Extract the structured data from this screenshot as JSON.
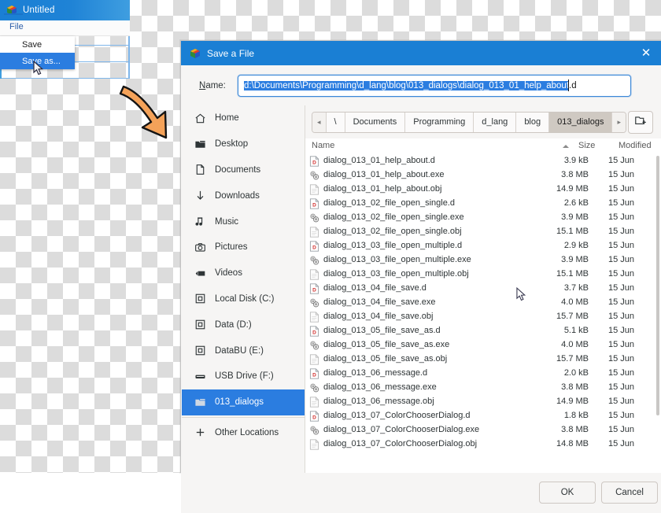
{
  "main_window": {
    "title": "Untitled",
    "icon": "cube-logo-icon",
    "menubar": {
      "file_label": "File"
    },
    "menu_popup": {
      "items": [
        {
          "label": "Save",
          "selected": false
        },
        {
          "label": "Save as...",
          "selected": true
        }
      ]
    }
  },
  "annotation": {
    "arrow": "orange-curved-arrow"
  },
  "dialog": {
    "title": "Save a File",
    "icon": "cube-logo-icon",
    "close_label": "✕",
    "name_row": {
      "label_prefix": "N",
      "label_rest": "ame:",
      "selected_text": "d:\\Documents\\Programming\\d_lang\\blog\\013_dialogs\\dialog_013_01_help_about",
      "unselected_text": ".d"
    },
    "sidebar": {
      "items": [
        {
          "label": "Home",
          "icon": "home-icon",
          "selected": false
        },
        {
          "label": "Desktop",
          "icon": "folder-icon",
          "selected": false
        },
        {
          "label": "Documents",
          "icon": "document-icon",
          "selected": false
        },
        {
          "label": "Downloads",
          "icon": "download-arrow-icon",
          "selected": false
        },
        {
          "label": "Music",
          "icon": "music-note-icon",
          "selected": false
        },
        {
          "label": "Pictures",
          "icon": "camera-icon",
          "selected": false
        },
        {
          "label": "Videos",
          "icon": "video-icon",
          "selected": false
        },
        {
          "label": "Local Disk (C:)",
          "icon": "drive-icon",
          "selected": false
        },
        {
          "label": "Data (D:)",
          "icon": "drive-icon",
          "selected": false
        },
        {
          "label": "DataBU (E:)",
          "icon": "drive-icon",
          "selected": false
        },
        {
          "label": "USB Drive (F:)",
          "icon": "usb-drive-icon",
          "selected": false
        },
        {
          "label": "013_dialogs",
          "icon": "folder-icon",
          "selected": true
        }
      ],
      "other_locations": {
        "label": "Other Locations",
        "icon": "plus-icon"
      }
    },
    "pathbar": {
      "back_arrow": "◂",
      "forward_arrow": "▸",
      "crumbs": [
        {
          "label": "\\",
          "active": false
        },
        {
          "label": "Documents",
          "active": false
        },
        {
          "label": "Programming",
          "active": false
        },
        {
          "label": "d_lang",
          "active": false
        },
        {
          "label": "blog",
          "active": false
        },
        {
          "label": "013_dialogs",
          "active": true
        }
      ],
      "new_folder_button": "new-folder-icon"
    },
    "list_header": {
      "name": "Name",
      "size": "Size",
      "modified": "Modified",
      "sort_column": "Name",
      "sort_direction": "ascending"
    },
    "files": [
      {
        "name": "dialog_013_01_help_about.d",
        "size": "3.9 kB",
        "modified": "15 Jun",
        "icon": "d-source-icon"
      },
      {
        "name": "dialog_013_01_help_about.exe",
        "size": "3.8 MB",
        "modified": "15 Jun",
        "icon": "executable-icon"
      },
      {
        "name": "dialog_013_01_help_about.obj",
        "size": "14.9 MB",
        "modified": "15 Jun",
        "icon": "plain-file-icon"
      },
      {
        "name": "dialog_013_02_file_open_single.d",
        "size": "2.6 kB",
        "modified": "15 Jun",
        "icon": "d-source-icon"
      },
      {
        "name": "dialog_013_02_file_open_single.exe",
        "size": "3.9 MB",
        "modified": "15 Jun",
        "icon": "executable-icon"
      },
      {
        "name": "dialog_013_02_file_open_single.obj",
        "size": "15.1 MB",
        "modified": "15 Jun",
        "icon": "plain-file-icon"
      },
      {
        "name": "dialog_013_03_file_open_multiple.d",
        "size": "2.9 kB",
        "modified": "15 Jun",
        "icon": "d-source-icon"
      },
      {
        "name": "dialog_013_03_file_open_multiple.exe",
        "size": "3.9 MB",
        "modified": "15 Jun",
        "icon": "executable-icon"
      },
      {
        "name": "dialog_013_03_file_open_multiple.obj",
        "size": "15.1 MB",
        "modified": "15 Jun",
        "icon": "plain-file-icon"
      },
      {
        "name": "dialog_013_04_file_save.d",
        "size": "3.7 kB",
        "modified": "15 Jun",
        "icon": "d-source-icon"
      },
      {
        "name": "dialog_013_04_file_save.exe",
        "size": "4.0 MB",
        "modified": "15 Jun",
        "icon": "executable-icon"
      },
      {
        "name": "dialog_013_04_file_save.obj",
        "size": "15.7 MB",
        "modified": "15 Jun",
        "icon": "plain-file-icon"
      },
      {
        "name": "dialog_013_05_file_save_as.d",
        "size": "5.1 kB",
        "modified": "15 Jun",
        "icon": "d-source-icon"
      },
      {
        "name": "dialog_013_05_file_save_as.exe",
        "size": "4.0 MB",
        "modified": "15 Jun",
        "icon": "executable-icon"
      },
      {
        "name": "dialog_013_05_file_save_as.obj",
        "size": "15.7 MB",
        "modified": "15 Jun",
        "icon": "plain-file-icon"
      },
      {
        "name": "dialog_013_06_message.d",
        "size": "2.0 kB",
        "modified": "15 Jun",
        "icon": "d-source-icon"
      },
      {
        "name": "dialog_013_06_message.exe",
        "size": "3.8 MB",
        "modified": "15 Jun",
        "icon": "executable-icon"
      },
      {
        "name": "dialog_013_06_message.obj",
        "size": "14.9 MB",
        "modified": "15 Jun",
        "icon": "plain-file-icon"
      },
      {
        "name": "dialog_013_07_ColorChooserDialog.d",
        "size": "1.8 kB",
        "modified": "15 Jun",
        "icon": "d-source-icon"
      },
      {
        "name": "dialog_013_07_ColorChooserDialog.exe",
        "size": "3.8 MB",
        "modified": "15 Jun",
        "icon": "executable-icon"
      },
      {
        "name": "dialog_013_07_ColorChooserDialog.obj",
        "size": "14.8 MB",
        "modified": "15 Jun",
        "icon": "plain-file-icon"
      }
    ],
    "actions": {
      "ok_label": "OK",
      "cancel_label": "Cancel"
    }
  },
  "colors": {
    "titlebar_blue": "#1a7fd4",
    "selection_blue": "#2b7de0",
    "dialog_bg": "#f6f5f4",
    "annotation_orange": "#f4a259",
    "crumb_active": "#cfc9c2"
  }
}
